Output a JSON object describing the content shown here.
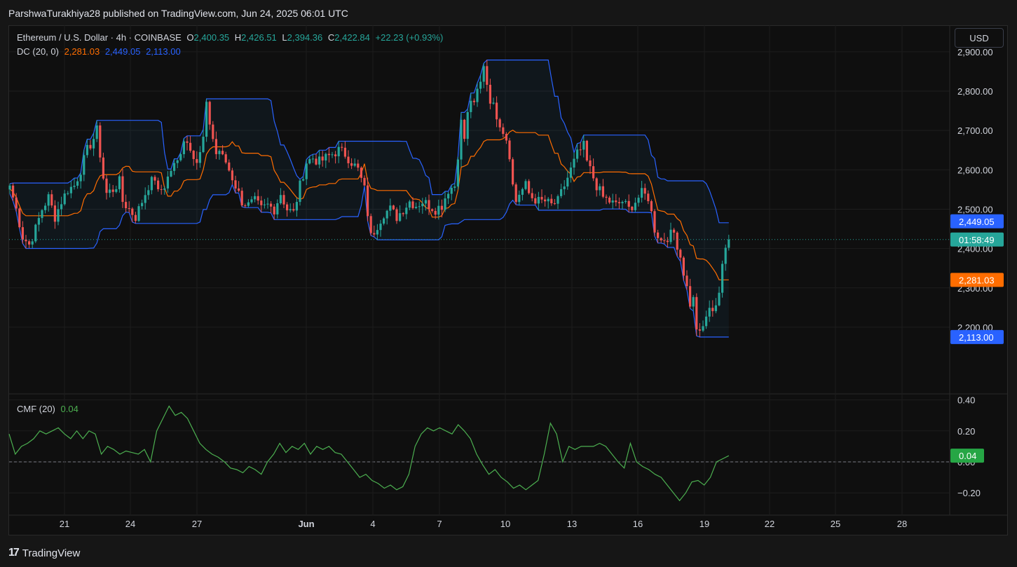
{
  "header": {
    "published_by": "ParshwaTurakhiya28 published on TradingView.com, Jun 24, 2025 06:01 UTC"
  },
  "legend": {
    "symbol": "Ethereum / U.S. Dollar · 4h · COINBASE",
    "o_label": "O",
    "o": "2,400.35",
    "h_label": "H",
    "h": "2,426.51",
    "l_label": "L",
    "l": "2,394.36",
    "c_label": "C",
    "c": "2,422.84",
    "change": "+22.23 (+0.93%)",
    "dc_label": "DC (20, 0)",
    "dc_mid": "2,281.03",
    "dc_upper": "2,449.05",
    "dc_lower": "2,113.00",
    "cmf_label": "CMF (20)",
    "cmf_value": "0.04"
  },
  "currency_button": "USD",
  "price_tags": {
    "upper": "2,449.05",
    "countdown": "01:58:49",
    "mid": "2,281.03",
    "lower": "2,113.00",
    "cmf": "0.04"
  },
  "colors": {
    "up": "#26a69a",
    "down": "#ef5350",
    "dc_upper": "#2962ff",
    "dc_mid": "#ff6d00",
    "cmf": "#4caf50"
  },
  "footer": {
    "logo": "17",
    "brand": "TradingView"
  },
  "chart_data": [
    {
      "type": "candlestick",
      "title": "Ethereum / U.S. Dollar · 4h · COINBASE",
      "x_ticks": [
        "21",
        "24",
        "27",
        "Jun",
        "4",
        "7",
        "10",
        "13",
        "16",
        "19",
        "22",
        "25",
        "28"
      ],
      "y_ticks": [
        2200,
        2300,
        2400,
        2500,
        2600,
        2700,
        2800,
        2900
      ],
      "y_tick_labels": [
        "2,200.00",
        "2,300.00",
        "2,400.00",
        "2,500.00",
        "2,600.00",
        "2,700.00",
        "2,800.00",
        "2,900.00"
      ],
      "ylim": [
        2060,
        2920
      ],
      "last_price": 2422.84,
      "close_path": [
        [
          0,
          2560
        ],
        [
          2,
          2500
        ],
        [
          4,
          2430
        ],
        [
          6,
          2410
        ],
        [
          8,
          2450
        ],
        [
          10,
          2500
        ],
        [
          12,
          2530
        ],
        [
          14,
          2480
        ],
        [
          16,
          2520
        ],
        [
          18,
          2550
        ],
        [
          20,
          2560
        ],
        [
          22,
          2600
        ],
        [
          24,
          2650
        ],
        [
          26,
          2680
        ],
        [
          27,
          2700
        ],
        [
          28,
          2640
        ],
        [
          29,
          2580
        ],
        [
          30,
          2540
        ],
        [
          32,
          2550
        ],
        [
          34,
          2570
        ],
        [
          35,
          2520
        ],
        [
          37,
          2500
        ],
        [
          39,
          2480
        ],
        [
          41,
          2520
        ],
        [
          43,
          2560
        ],
        [
          45,
          2580
        ],
        [
          46,
          2540
        ],
        [
          48,
          2560
        ],
        [
          50,
          2600
        ],
        [
          52,
          2620
        ],
        [
          54,
          2680
        ],
        [
          56,
          2660
        ],
        [
          58,
          2620
        ],
        [
          59,
          2640
        ],
        [
          60,
          2680
        ],
        [
          61,
          2760
        ],
        [
          62,
          2720
        ],
        [
          63,
          2680
        ],
        [
          64,
          2640
        ],
        [
          65,
          2650
        ],
        [
          66,
          2630
        ],
        [
          67,
          2620
        ],
        [
          68,
          2600
        ],
        [
          70,
          2560
        ],
        [
          72,
          2520
        ],
        [
          74,
          2510
        ],
        [
          76,
          2520
        ],
        [
          78,
          2500
        ],
        [
          80,
          2510
        ],
        [
          82,
          2500
        ],
        [
          84,
          2540
        ],
        [
          86,
          2500
        ],
        [
          88,
          2490
        ],
        [
          90,
          2560
        ],
        [
          92,
          2620
        ],
        [
          94,
          2630
        ],
        [
          96,
          2620
        ],
        [
          98,
          2630
        ],
        [
          100,
          2640
        ],
        [
          102,
          2650
        ],
        [
          104,
          2640
        ],
        [
          106,
          2620
        ],
        [
          108,
          2600
        ],
        [
          110,
          2550
        ],
        [
          112,
          2430
        ],
        [
          114,
          2460
        ],
        [
          116,
          2490
        ],
        [
          118,
          2500
        ],
        [
          120,
          2480
        ],
        [
          122,
          2500
        ],
        [
          124,
          2520
        ],
        [
          126,
          2510
        ],
        [
          128,
          2520
        ],
        [
          130,
          2510
        ],
        [
          132,
          2500
        ],
        [
          134,
          2510
        ],
        [
          136,
          2550
        ],
        [
          138,
          2560
        ],
        [
          139,
          2640
        ],
        [
          140,
          2720
        ],
        [
          141,
          2680
        ],
        [
          142,
          2740
        ],
        [
          143,
          2780
        ],
        [
          144,
          2760
        ],
        [
          145,
          2800
        ],
        [
          146,
          2820
        ],
        [
          147,
          2870
        ],
        [
          148,
          2820
        ],
        [
          149,
          2780
        ],
        [
          150,
          2760
        ],
        [
          151,
          2740
        ],
        [
          152,
          2720
        ],
        [
          153,
          2700
        ],
        [
          154,
          2680
        ],
        [
          155,
          2640
        ],
        [
          156,
          2560
        ],
        [
          157,
          2520
        ],
        [
          158,
          2540
        ],
        [
          159,
          2550
        ],
        [
          160,
          2560
        ],
        [
          161,
          2540
        ],
        [
          162,
          2530
        ],
        [
          164,
          2520
        ],
        [
          166,
          2520
        ],
        [
          168,
          2510
        ],
        [
          170,
          2520
        ],
        [
          172,
          2560
        ],
        [
          174,
          2600
        ],
        [
          176,
          2640
        ],
        [
          178,
          2660
        ],
        [
          179,
          2620
        ],
        [
          180,
          2600
        ],
        [
          181,
          2580
        ],
        [
          182,
          2560
        ],
        [
          184,
          2530
        ],
        [
          186,
          2520
        ],
        [
          188,
          2510
        ],
        [
          190,
          2520
        ],
        [
          192,
          2500
        ],
        [
          194,
          2520
        ],
        [
          196,
          2540
        ],
        [
          198,
          2530
        ],
        [
          200,
          2450
        ],
        [
          202,
          2420
        ],
        [
          204,
          2430
        ],
        [
          206,
          2440
        ],
        [
          208,
          2380
        ],
        [
          210,
          2300
        ],
        [
          211,
          2260
        ],
        [
          212,
          2270
        ],
        [
          213,
          2200
        ],
        [
          214,
          2180
        ],
        [
          215,
          2200
        ],
        [
          216,
          2230
        ],
        [
          217,
          2240
        ],
        [
          218,
          2250
        ],
        [
          219,
          2260
        ],
        [
          220,
          2290
        ],
        [
          221,
          2350
        ],
        [
          222,
          2400
        ],
        [
          223,
          2420
        ]
      ]
    },
    {
      "type": "line",
      "title": "CMF (20)",
      "y_ticks": [
        -0.2,
        0.0,
        0.2,
        0.4
      ],
      "y_tick_labels": [
        "−0.20",
        "0.00",
        "0.20",
        "0.40"
      ],
      "ylim": [
        -0.3,
        0.45
      ],
      "last_value": 0.04,
      "series": [
        {
          "name": "CMF (20)",
          "values": [
            0.18,
            0.05,
            0.1,
            0.12,
            0.15,
            0.2,
            0.18,
            0.2,
            0.22,
            0.18,
            0.15,
            0.2,
            0.15,
            0.2,
            0.18,
            0.05,
            0.1,
            0.08,
            0.05,
            0.07,
            0.06,
            0.05,
            0.08,
            0.0,
            0.2,
            0.28,
            0.36,
            0.3,
            0.32,
            0.28,
            0.2,
            0.12,
            0.08,
            0.05,
            0.03,
            0.0,
            -0.04,
            -0.05,
            -0.07,
            -0.03,
            -0.05,
            -0.08,
            0.0,
            0.05,
            0.12,
            0.06,
            0.1,
            0.08,
            0.12,
            0.05,
            0.1,
            0.08,
            0.1,
            0.06,
            0.05,
            0.0,
            -0.05,
            -0.1,
            -0.08,
            -0.12,
            -0.14,
            -0.17,
            -0.15,
            -0.18,
            -0.16,
            -0.08,
            0.1,
            0.18,
            0.22,
            0.2,
            0.22,
            0.2,
            0.18,
            0.24,
            0.2,
            0.15,
            0.05,
            -0.02,
            -0.08,
            -0.05,
            -0.1,
            -0.13,
            -0.17,
            -0.15,
            -0.18,
            -0.15,
            -0.12,
            0.05,
            0.25,
            0.18,
            0.0,
            0.1,
            0.08,
            0.1,
            0.1,
            0.1,
            0.12,
            0.1,
            0.05,
            0.0,
            -0.04,
            0.12,
            0.0,
            -0.03,
            -0.05,
            -0.08,
            -0.1,
            -0.15,
            -0.2,
            -0.25,
            -0.2,
            -0.13,
            -0.12,
            -0.15,
            -0.1,
            0.0,
            0.02,
            0.04
          ]
        }
      ]
    }
  ]
}
